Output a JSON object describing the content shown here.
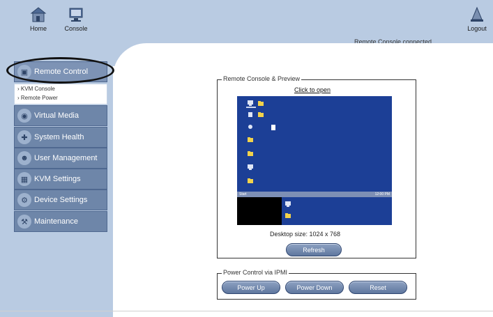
{
  "header": {
    "home_label": "Home",
    "console_label": "Console",
    "logout_label": "Logout",
    "status_text": "Remote Console connected"
  },
  "sidebar": {
    "items": [
      {
        "label": "Remote Control",
        "icon": "remote-control-icon"
      },
      {
        "label": "Virtual Media",
        "icon": "disc-icon"
      },
      {
        "label": "System Health",
        "icon": "health-icon"
      },
      {
        "label": "User Management",
        "icon": "users-icon"
      },
      {
        "label": "KVM Settings",
        "icon": "kvm-icon"
      },
      {
        "label": "Device Settings",
        "icon": "device-icon"
      },
      {
        "label": "Maintenance",
        "icon": "tools-icon"
      }
    ],
    "subitems": [
      {
        "label": "KVM Console"
      },
      {
        "label": "Remote Power"
      }
    ]
  },
  "preview": {
    "legend": "Remote Console & Preview",
    "link": "Click to open",
    "taskbar_left": "Start",
    "taskbar_right": "12:00 PM",
    "desktop_size": "Desktop size: 1024 x 768",
    "refresh_label": "Refresh"
  },
  "power": {
    "legend": "Power Control via IPMI",
    "power_up_label": "Power Up",
    "power_down_label": "Power Down",
    "reset_label": "Reset"
  },
  "colors": {
    "background": "#b9cbe2",
    "nav_button": "#6e86a9",
    "desktop": "#1c3f96",
    "pill_button": "#6b82a8"
  }
}
